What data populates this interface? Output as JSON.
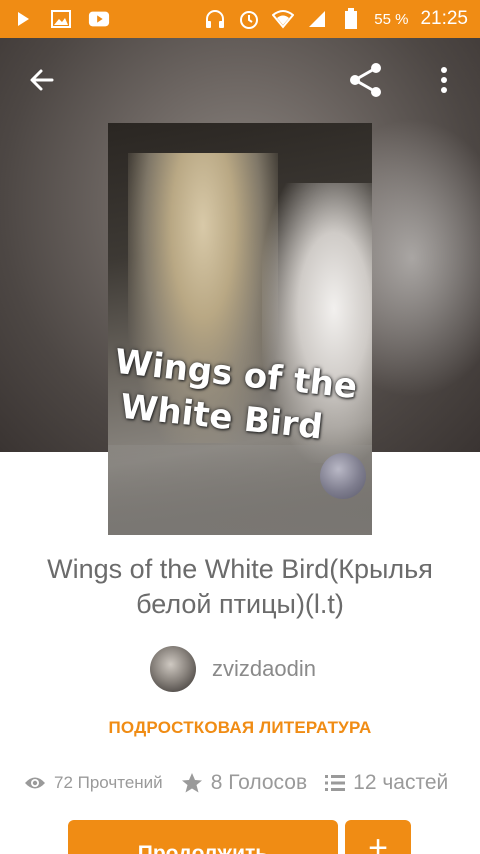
{
  "status_bar": {
    "battery": "55 %",
    "time": "21:25"
  },
  "colors": {
    "accent": "#f08c14",
    "title_text": "#6b6b6b",
    "muted_text": "#9a9a9a"
  },
  "cover": {
    "title_line1": "Wings of the",
    "title_line2": "White Bird"
  },
  "book": {
    "title": "Wings of the White Bird(Крылья белой птицы)(l.t)",
    "author": "zvizdaodin",
    "category": "ПОДРОСТКОВАЯ ЛИТЕРАТУРА"
  },
  "stats": {
    "reads": "72 Прочтений",
    "votes": "8 Голосов",
    "parts": "12 частей"
  },
  "actions": {
    "continue_label": "Продолжить",
    "add_label": "+"
  },
  "icons": {
    "back": "arrow-left-icon",
    "share": "share-icon",
    "more": "more-vert-icon",
    "reads": "eye-icon",
    "votes": "star-icon",
    "parts": "list-icon"
  }
}
